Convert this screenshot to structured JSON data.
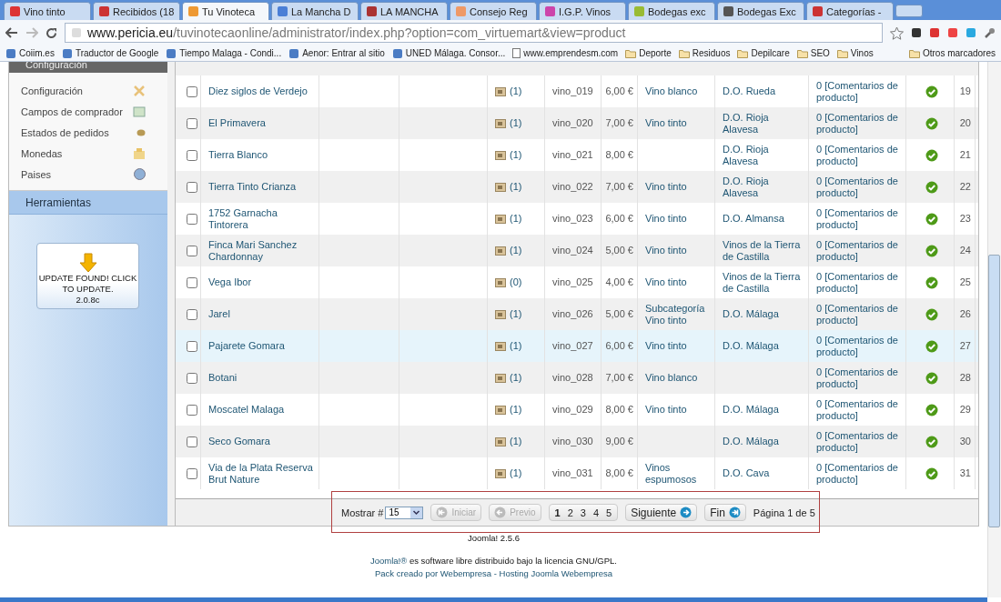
{
  "browser": {
    "tabs": [
      {
        "label": "Vino tinto",
        "selected": false
      },
      {
        "label": "Recibidos (18",
        "selected": false
      },
      {
        "label": "Tu Vinoteca",
        "selected": true
      },
      {
        "label": "La Mancha D",
        "selected": false
      },
      {
        "label": "LA MANCHA",
        "selected": false
      },
      {
        "label": "Consejo Reg",
        "selected": false
      },
      {
        "label": "I.G.P. Vinos",
        "selected": false
      },
      {
        "label": "Bodegas exc",
        "selected": false
      },
      {
        "label": "Bodegas Exc",
        "selected": false
      },
      {
        "label": "Categorías -",
        "selected": false
      }
    ],
    "url_host": "www.pericia.eu",
    "url_path": "/tuvinotecaonline/administrator/index.php?option=com_virtuemart&view=product",
    "bookmarks": [
      {
        "label": "Coiim.es",
        "kind": "site"
      },
      {
        "label": "Traductor de Google",
        "kind": "site"
      },
      {
        "label": "Tiempo Malaga - Condi...",
        "kind": "site"
      },
      {
        "label": "Aenor: Entrar al sitio",
        "kind": "site"
      },
      {
        "label": "UNED Málaga. Consor...",
        "kind": "site"
      },
      {
        "label": "www.emprendesm.com",
        "kind": "page"
      },
      {
        "label": "Deporte",
        "kind": "folder"
      },
      {
        "label": "Residuos",
        "kind": "folder"
      },
      {
        "label": "Depilcare",
        "kind": "folder"
      },
      {
        "label": "SEO",
        "kind": "folder"
      },
      {
        "label": "Vinos",
        "kind": "folder"
      }
    ],
    "other_bookmarks": "Otros marcadores"
  },
  "sidebar": {
    "section_title": "Configuración",
    "items": [
      {
        "label": "Configuración",
        "kind": "tools"
      },
      {
        "label": "Campos de comprador",
        "kind": "form"
      },
      {
        "label": "Estados de pedidos",
        "kind": "status"
      },
      {
        "label": "Monedas",
        "kind": "coins"
      },
      {
        "label": "Paises",
        "kind": "globe"
      }
    ],
    "tools_title": "Herramientas",
    "update_notice": "UPDATE FOUND! CLICK TO UPDATE.",
    "update_version": "2.0.8c"
  },
  "products": {
    "rows": [
      {
        "checked": false,
        "name": "Diez siglos de Verdejo",
        "media": "(1)",
        "sku": "vino_019",
        "price": "6,00 €",
        "category": "Vino blanco",
        "manufacturer": "D.O. Rueda",
        "reviews": "0 [Comentarios de producto]",
        "published": true,
        "id": "19",
        "highlighted": false
      },
      {
        "checked": false,
        "name": "El Primavera",
        "media": "(1)",
        "sku": "vino_020",
        "price": "7,00 €",
        "category": "Vino tinto",
        "manufacturer": "D.O. Rioja Alavesa",
        "reviews": "0 [Comentarios de producto]",
        "published": true,
        "id": "20",
        "highlighted": false
      },
      {
        "checked": false,
        "name": "Tierra Blanco",
        "media": "(1)",
        "sku": "vino_021",
        "price": "8,00 €",
        "manufacturer": "D.O. Rioja Alavesa",
        "reviews": "0 [Comentarios de producto]",
        "published": true,
        "id": "21",
        "highlighted": false
      },
      {
        "checked": false,
        "name": "Tierra Tinto Crianza",
        "media": "(1)",
        "sku": "vino_022",
        "price": "7,00 €",
        "category": "Vino tinto",
        "manufacturer": "D.O. Rioja Alavesa",
        "reviews": "0 [Comentarios de producto]",
        "published": true,
        "id": "22",
        "highlighted": false
      },
      {
        "checked": false,
        "name": "1752 Garnacha Tintorera",
        "media": "(1)",
        "sku": "vino_023",
        "price": "6,00 €",
        "category": "Vino tinto",
        "manufacturer": "D.O. Almansa",
        "reviews": "0 [Comentarios de producto]",
        "published": true,
        "id": "23",
        "highlighted": false
      },
      {
        "checked": false,
        "name": "Finca Mari Sanchez Chardonnay",
        "media": "(1)",
        "sku": "vino_024",
        "price": "5,00 €",
        "category": "Vino tinto",
        "manufacturer": "Vinos de la Tierra de Castilla",
        "reviews": "0 [Comentarios de producto]",
        "published": true,
        "id": "24",
        "highlighted": false
      },
      {
        "checked": false,
        "name": "Vega Ibor",
        "media": "(0)",
        "sku": "vino_025",
        "price": "4,00 €",
        "category": "Vino tinto",
        "manufacturer": "Vinos de la Tierra de Castilla",
        "reviews": "0 [Comentarios de producto]",
        "published": true,
        "id": "25",
        "highlighted": false
      },
      {
        "checked": false,
        "name": "Jarel",
        "media": "(1)",
        "sku": "vino_026",
        "price": "5,00 €",
        "category": "Subcategoría Vino tinto",
        "manufacturer": "D.O. Málaga",
        "reviews": "0 [Comentarios de producto]",
        "published": true,
        "id": "26",
        "highlighted": false
      },
      {
        "checked": false,
        "name": "Pajarete Gomara",
        "media": "(1)",
        "sku": "vino_027",
        "price": "6,00 €",
        "category": "Vino tinto",
        "manufacturer": "D.O. Málaga",
        "reviews": "0 [Comentarios de producto]",
        "published": true,
        "id": "27",
        "highlighted": true
      },
      {
        "checked": false,
        "name": "Botani",
        "media": "(1)",
        "sku": "vino_028",
        "price": "7,00 €",
        "category": "Vino blanco",
        "reviews": "0 [Comentarios de producto]",
        "published": true,
        "id": "28",
        "highlighted": false
      },
      {
        "checked": false,
        "name": "Moscatel Malaga",
        "media": "(1)",
        "sku": "vino_029",
        "price": "8,00 €",
        "category": "Vino tinto",
        "manufacturer": "D.O. Málaga",
        "reviews": "0 [Comentarios de producto]",
        "published": true,
        "id": "29",
        "highlighted": false
      },
      {
        "checked": false,
        "name": "Seco Gomara",
        "media": "(1)",
        "sku": "vino_030",
        "price": "9,00 €",
        "manufacturer": "D.O. Málaga",
        "reviews": "0 [Comentarios de producto]",
        "published": true,
        "id": "30",
        "highlighted": false
      },
      {
        "checked": false,
        "name": "Via de la Plata Reserva Brut Nature",
        "media": "(1)",
        "sku": "vino_031",
        "price": "8,00 €",
        "category": "Vinos espumosos",
        "manufacturer": "D.O. Cava",
        "reviews": "0 [Comentarios de producto]",
        "published": true,
        "id": "31",
        "highlighted": false
      }
    ]
  },
  "pagination": {
    "show_label": "Mostrar #",
    "limit": "15",
    "before": [
      {
        "label": "Iniciar",
        "kind": "first",
        "disabled": true
      },
      {
        "label": "Previo",
        "kind": "prev",
        "disabled": true
      }
    ],
    "pages": [
      {
        "label": "1",
        "selected": true
      },
      {
        "label": "2",
        "selected": false
      },
      {
        "label": "3",
        "selected": false
      },
      {
        "label": "4",
        "selected": false
      },
      {
        "label": "5",
        "selected": false
      }
    ],
    "after": [
      {
        "label": "Siguiente",
        "kind": "next",
        "disabled": false
      },
      {
        "label": "Fin",
        "kind": "last",
        "disabled": false
      }
    ],
    "page_info": "Página 1 de 5"
  },
  "footer": {
    "version": "Joomla! 2.5.6",
    "license_link": "Joomla!®",
    "license_text": "es software libre distribuido bajo la licencia GNU/GPL.",
    "credits": "Pack creado por Webempresa - Hosting Joomla Webempresa"
  }
}
